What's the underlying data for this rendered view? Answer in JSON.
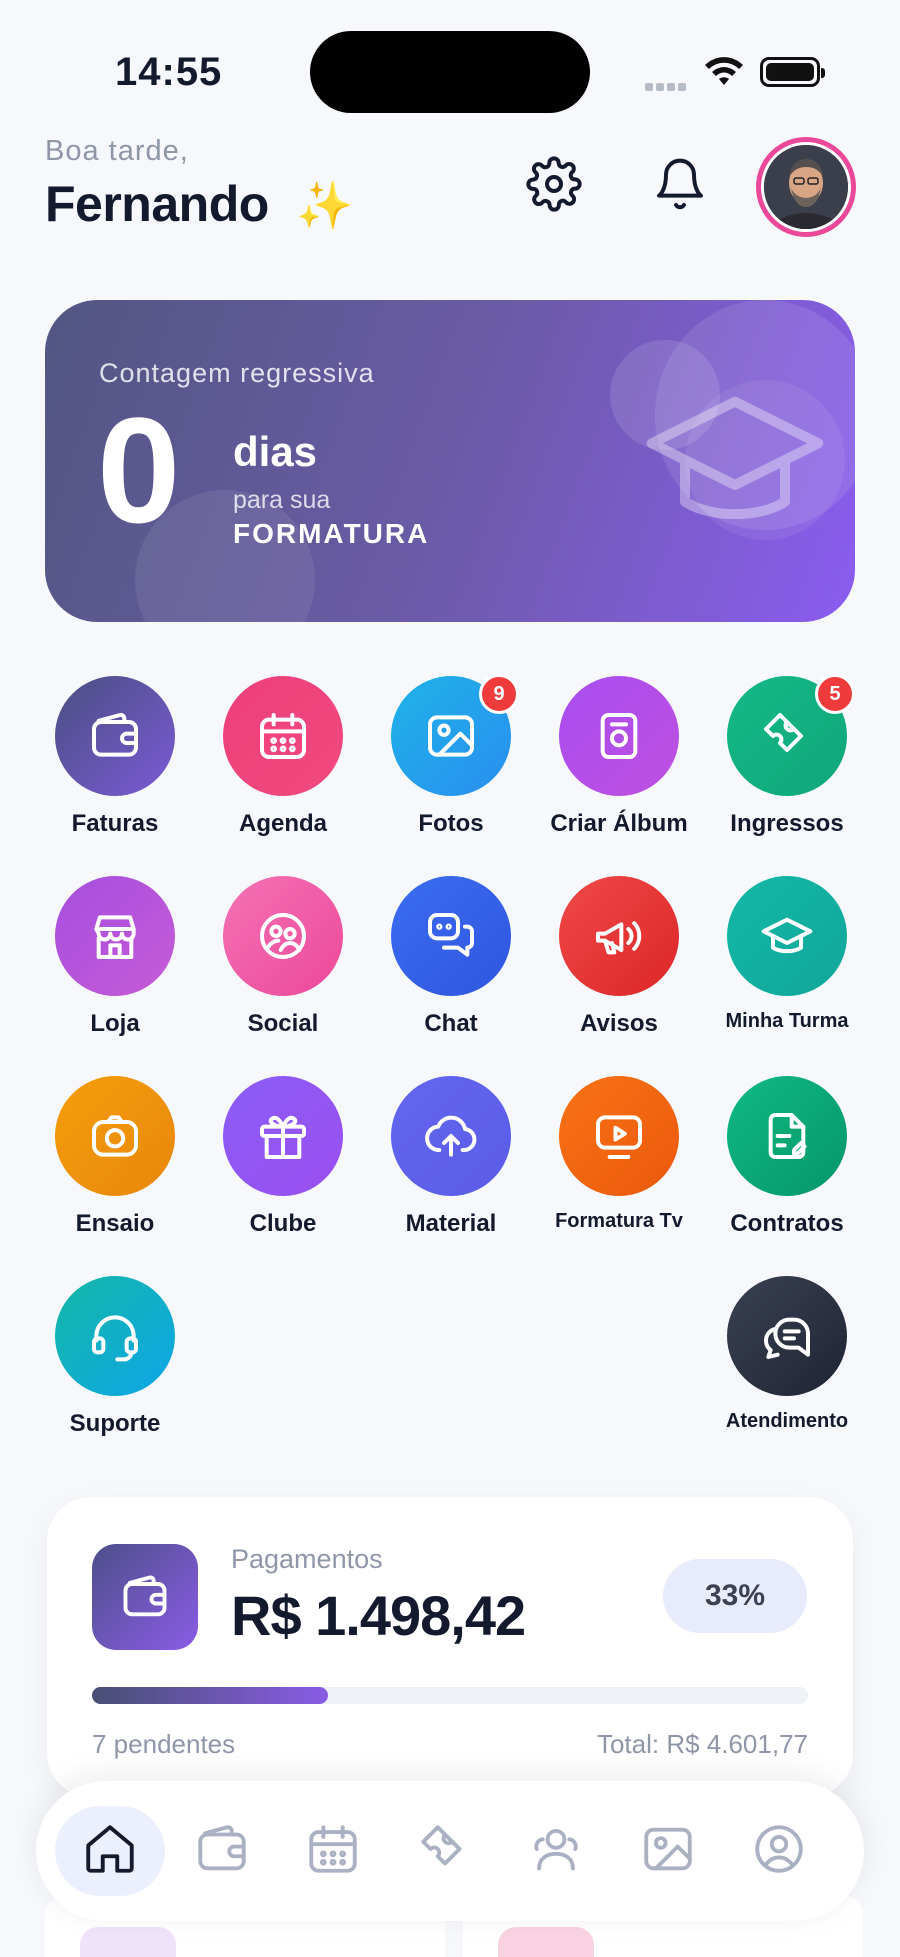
{
  "status_bar": {
    "time": "14:55"
  },
  "header": {
    "greeting": "Boa tarde,",
    "user_name": "Fernando",
    "sparkle": "✨"
  },
  "countdown": {
    "label": "Contagem regressiva",
    "number": "0",
    "unit": "dias",
    "subtitle": "para sua",
    "event": "FORMATURA"
  },
  "shortcuts": [
    {
      "label": "Faturas",
      "icon": "wallet-icon",
      "color_from": "#4b4f82",
      "color_to": "#7a5ad6"
    },
    {
      "label": "Agenda",
      "icon": "calendar-icon",
      "color_from": "#ee3f7a",
      "color_to": "#f0497f"
    },
    {
      "label": "Fotos",
      "icon": "image-icon",
      "color_from": "#1fb3e8",
      "color_to": "#2a8ef0",
      "badge": "9"
    },
    {
      "label": "Criar Álbum",
      "icon": "album-icon",
      "color_from": "#a84ef0",
      "color_to": "#c04fe0"
    },
    {
      "label": "Ingressos",
      "icon": "ticket-icon",
      "color_from": "#15b886",
      "color_to": "#0fa77a",
      "badge": "5"
    },
    {
      "label": "Loja",
      "icon": "store-icon",
      "color_from": "#a64ee0",
      "color_to": "#c65bd6"
    },
    {
      "label": "Social",
      "icon": "social-icon",
      "color_from": "#f472b6",
      "color_to": "#ec4899"
    },
    {
      "label": "Chat",
      "icon": "chat-icon",
      "color_from": "#3b6df0",
      "color_to": "#2f55e0"
    },
    {
      "label": "Avisos",
      "icon": "megaphone-icon",
      "color_from": "#f04848",
      "color_to": "#dc2626"
    },
    {
      "label": "Minha Turma",
      "icon": "graduation-cap-icon",
      "color_from": "#14b8a6",
      "color_to": "#10a69a"
    },
    {
      "label": "Ensaio",
      "icon": "camera-icon",
      "color_from": "#f59e0b",
      "color_to": "#e8870c"
    },
    {
      "label": "Clube",
      "icon": "gift-icon",
      "color_from": "#8b5cf6",
      "color_to": "#9a4ff0"
    },
    {
      "label": "Material",
      "icon": "cloud-upload-icon",
      "color_from": "#6366f1",
      "color_to": "#5a5ce8"
    },
    {
      "label": "Formatura Tv",
      "icon": "tv-icon",
      "color_from": "#f97316",
      "color_to": "#ea580c"
    },
    {
      "label": "Contratos",
      "icon": "contract-icon",
      "color_from": "#10b981",
      "color_to": "#059669"
    },
    {
      "label": "Suporte",
      "icon": "headset-icon",
      "color_from": "#14b8a6",
      "color_to": "#0ea5e9"
    },
    {
      "label": "Atendimento",
      "icon": "chat-bubbles-icon",
      "color_from": "#3a4152",
      "color_to": "#1e2433"
    }
  ],
  "payments": {
    "title": "Pagamentos",
    "amount": "R$ 1.498,42",
    "percent_label": "33%",
    "progress": 0.33,
    "pending": "7 pendentes",
    "total": "Total: R$ 4.601,77"
  },
  "bottom_nav": [
    {
      "name": "home",
      "icon": "home-icon",
      "active": true
    },
    {
      "name": "wallet",
      "icon": "wallet-icon",
      "active": false
    },
    {
      "name": "calendar",
      "icon": "calendar-icon",
      "active": false
    },
    {
      "name": "tickets",
      "icon": "ticket-icon",
      "active": false
    },
    {
      "name": "community",
      "icon": "users-icon",
      "active": false
    },
    {
      "name": "gallery",
      "icon": "image-icon",
      "active": false
    },
    {
      "name": "profile",
      "icon": "profile-icon",
      "active": false
    }
  ],
  "colors": {
    "accent": "#8b5cf6",
    "avatar_ring": "#ec4899",
    "badge": "#ef3b3b",
    "text_primary": "#141a2e",
    "text_muted": "#8e96a8"
  }
}
